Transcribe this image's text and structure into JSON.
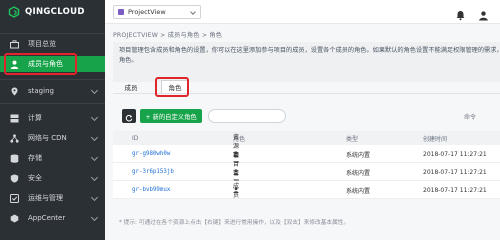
{
  "brand": {
    "name": "QINGCLOUD"
  },
  "topbar": {
    "project": "ProjectView"
  },
  "sidebar": {
    "items": [
      {
        "label": "项目总览",
        "icon": "briefcase-icon"
      },
      {
        "label": "成员与角色",
        "icon": "user-icon",
        "active": true
      },
      {
        "label": "staging",
        "icon": "location-pin-icon"
      },
      {
        "label": "计算",
        "icon": "server-icon"
      },
      {
        "label": "网络与 CDN",
        "icon": "network-icon"
      },
      {
        "label": "存储",
        "icon": "storage-icon"
      },
      {
        "label": "安全",
        "icon": "shield-icon"
      },
      {
        "label": "运维与管理",
        "icon": "tools-icon"
      },
      {
        "label": "AppCenter",
        "icon": "apps-icon"
      }
    ]
  },
  "breadcrumb": "PROJECTVIEW > 成员与角色 > 角色",
  "description": {
    "line1": "项目管理包含成员和角色的设置，你可以在这里添加参与项目的成员，设置各个成员的角色。如果默认的角色设置不能满足权限管理的需求，",
    "line2": "角色。"
  },
  "tabs": [
    {
      "label": "成员"
    },
    {
      "label": "角色",
      "active": true
    }
  ],
  "toolbar": {
    "new_label": "+ 新的自定义角色",
    "search_placeholder": "",
    "right_text": "命令"
  },
  "table": {
    "headers": {
      "id": "ID",
      "role": "角色",
      "type": "类型",
      "time": "创建时间"
    },
    "rows": [
      {
        "id": "gr-g980wh0w",
        "role": "资源管理员",
        "type": "系统内置",
        "time": "2018-07-17 11:27:21"
      },
      {
        "id": "gr-3r6p153jb",
        "role": "项目管理员",
        "type": "系统内置",
        "time": "2018-07-17 11:27:21"
      },
      {
        "id": "gr-bvb99mux",
        "role": "成员",
        "type": "系统内置",
        "time": "2018-07-17 11:27:21"
      }
    ]
  },
  "footnote": "* 提示: 可通过在各个资源上点击【右键】来进行常用操作，以及【双击】来修改基本属性。",
  "colors": {
    "accent": "#16a34a",
    "sidebar_bg": "#2b3035",
    "highlight": "#e0262b",
    "link": "#1d6fd6"
  }
}
